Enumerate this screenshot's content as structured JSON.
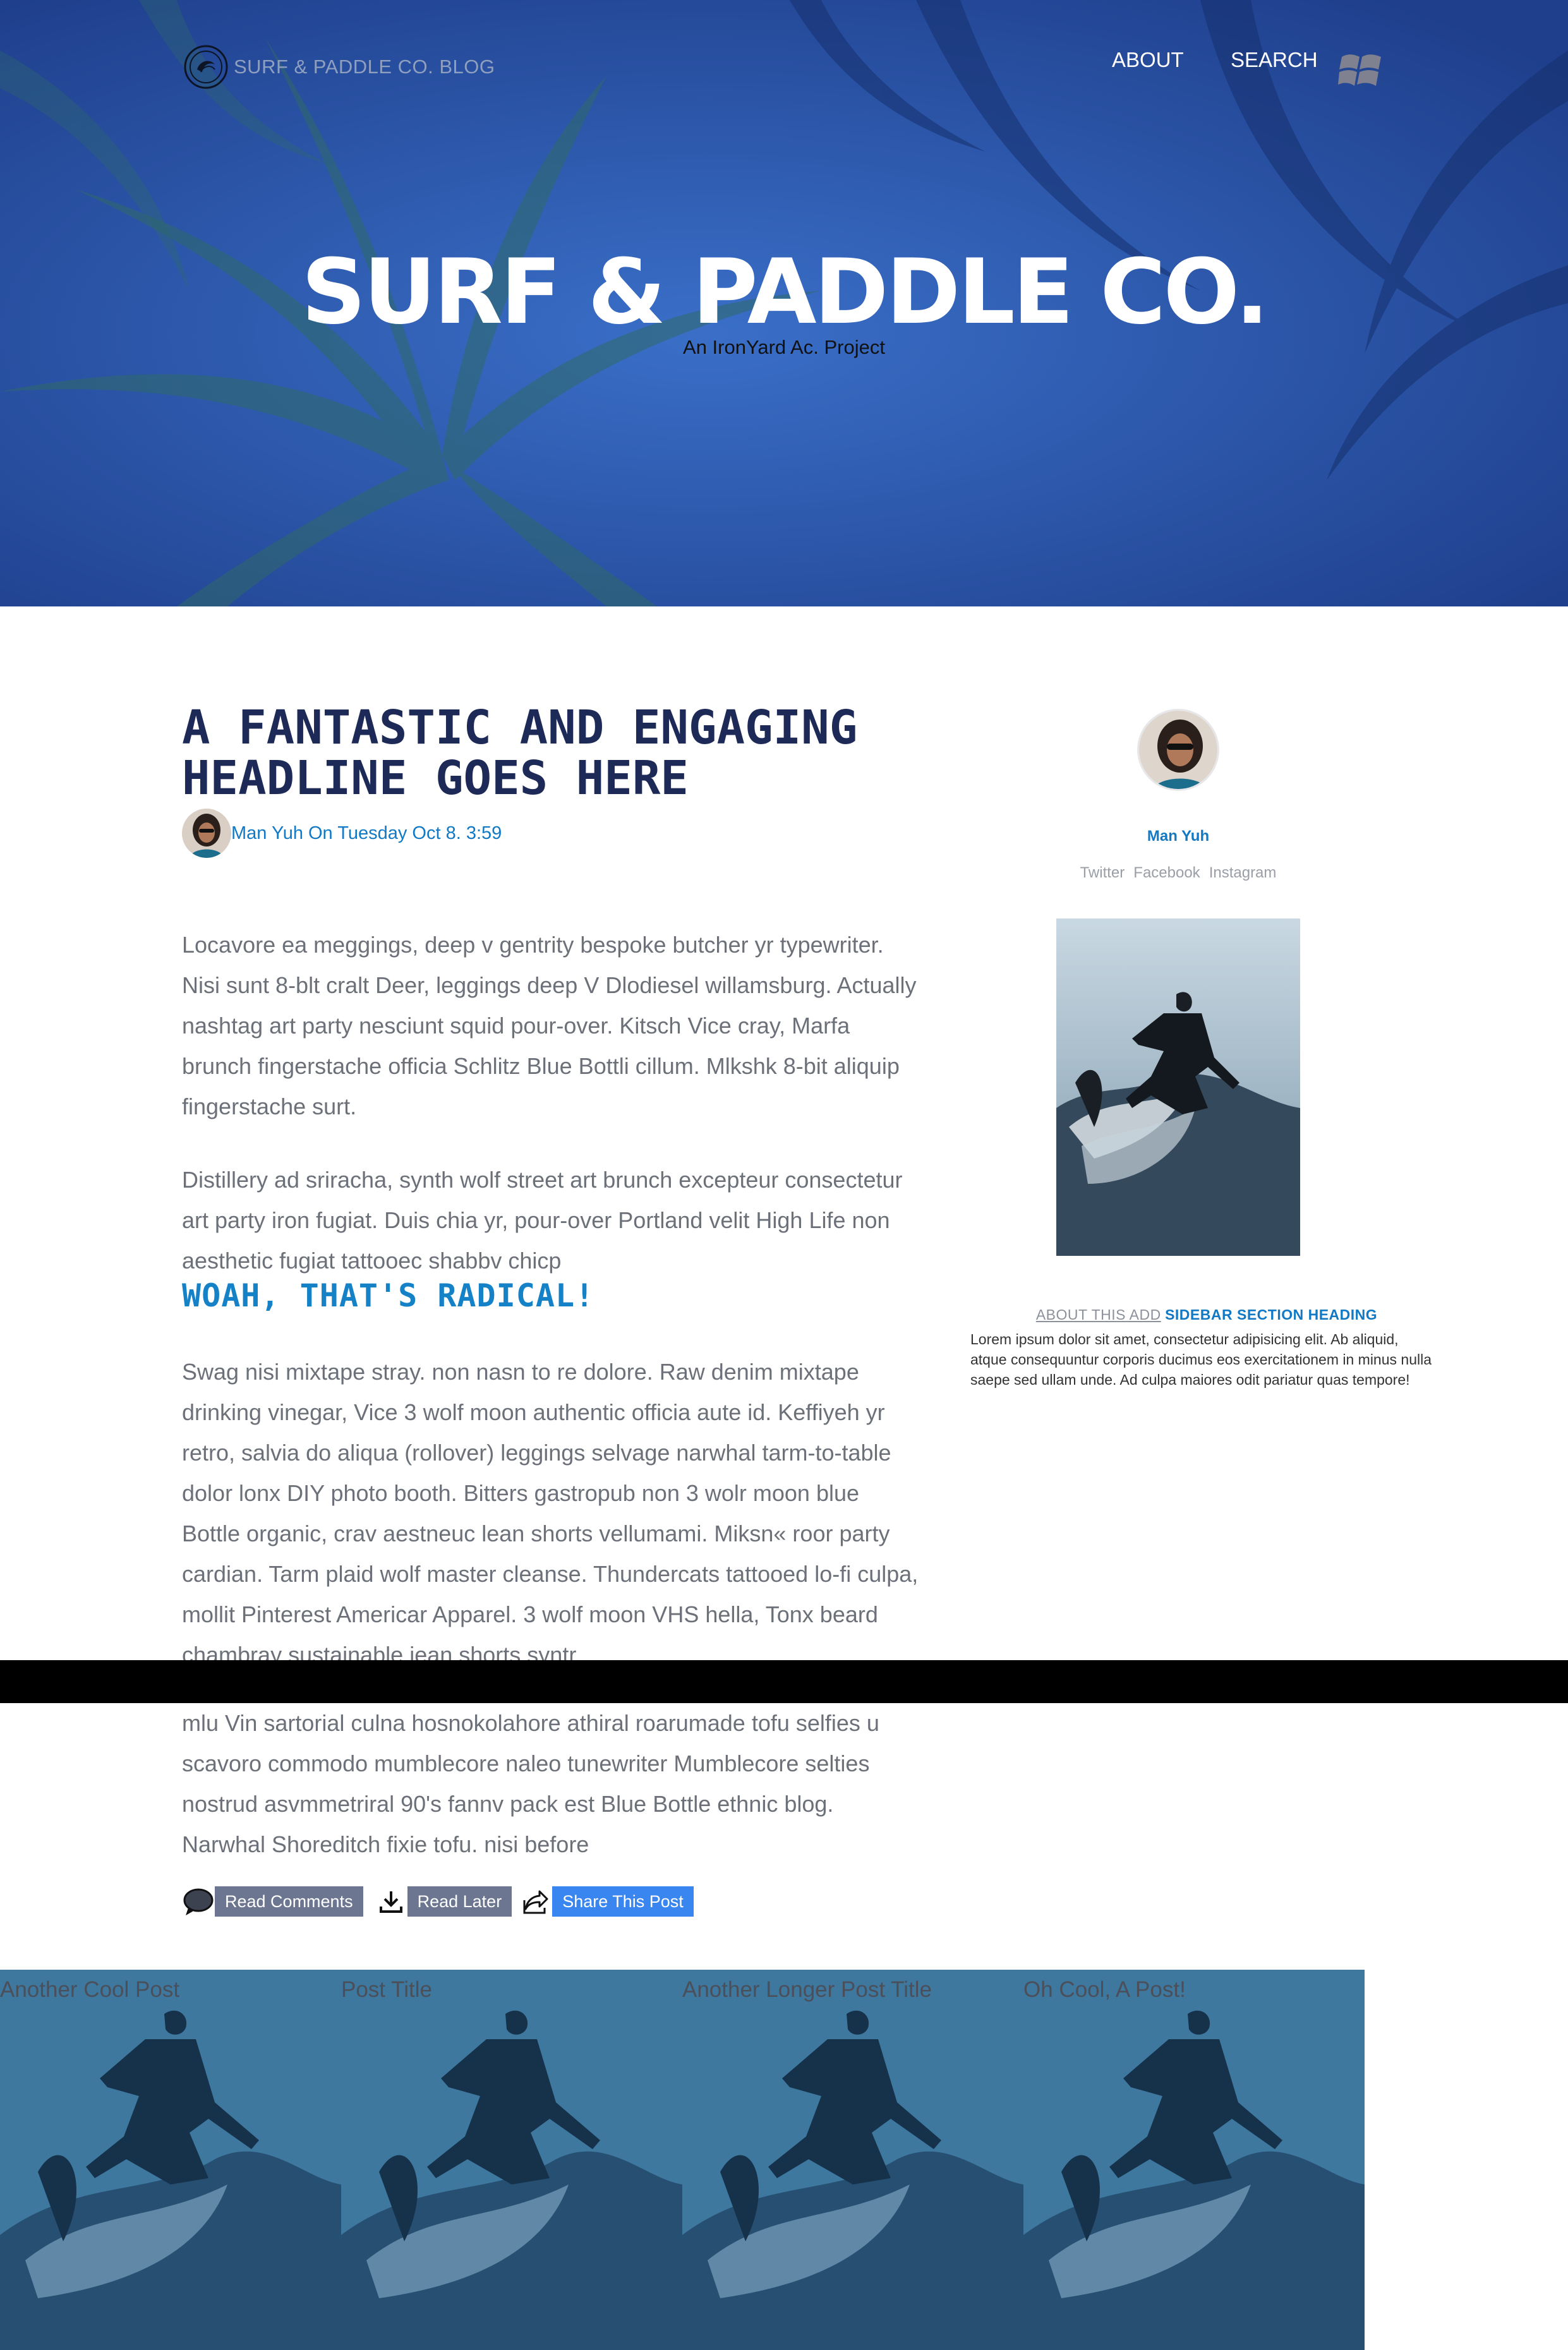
{
  "header": {
    "brand": "SURF & PADDLE CO. BLOG",
    "nav": [
      {
        "label": "ABOUT"
      },
      {
        "label": "SEARCH"
      }
    ]
  },
  "hero": {
    "title": "SURF & PADDLE CO.",
    "subtitle": "An IronYard Ac. Project"
  },
  "article": {
    "headline": "A FANTASTIC AND ENGAGING HEADLINE GOES HERE",
    "byline": "Man Yuh On Tuesday Oct 8. 3:59",
    "paragraphs": [
      "Locavore ea meggings, deep v gentrity bespoke butcher yr typewriter. Nisi sunt 8-blt cralt Deer, leggings deep V Dlodiesel willamsburg. Actually nashtag art party nesciunt squid pour-over. Kitsch Vice cray, Marfa brunch fingerstache officia Schlitz Blue Bottli cillum. Mlkshk 8-bit aliquip fingerstache surt.",
      "Distillery ad sriracha, synth wolf street art brunch excepteur consectetur art party iron fugiat. Duis chia yr, pour-over Portland velit High Life non aesthetic fugiat tattooec shabbv chicp",
      "Swag nisi mixtape stray. non nasn to re dolore. Raw denim mixtape drinking vinegar, Vice 3 wolf moon authentic officia aute id. Keffiyeh yr retro, salvia do aliqua (rollover) leggings selvage narwhal tarm-to-table dolor lonx DIY photo booth. Bitters gastropub non 3 wolr moon blue Bottle organic, crav aestneuc lean shorts vellumami. Miksn« roor party cardian. Tarm plaid wolf master cleanse. Thundercats tattooed lo-fi culpa, mollit Pinterest Americar Apparel. 3 wolf moon VHS hella, Tonx beard chambray sustainable jean shorts syntr",
      "mlu Vin sartorial culna hosnokolahore athiral roarumade tofu selfies u scavoro commodo mumblecore naleo tunewriter Mumblecore selties nostrud asvmmetriral 90's fannv pack est Blue Bottle ethnic blog. Narwhal Shoreditch fixie tofu. nisi before"
    ],
    "subheading": "WOAH, THAT'S RADICAL!",
    "actions": [
      {
        "label": "Read Comments",
        "icon": "speech-bubble-icon"
      },
      {
        "label": "Read Later",
        "icon": "download-icon"
      },
      {
        "label": "Share This Post",
        "icon": "share-icon"
      }
    ]
  },
  "sidebar": {
    "author_name": "Man Yuh",
    "social": [
      "Twitter",
      "Facebook",
      "Instagram"
    ],
    "heading_muted": "ABOUT THIS ADD",
    "heading_strong": "SIDEBAR SECTION HEADING",
    "body": "Lorem ipsum dolor sit amet, consectetur adipisicing elit. Ab aliquid, atque consequuntur corporis ducimus eos exercitationem in minus nulla saepe sed ullam unde. Ad culpa maiores odit pariatur quas tempore!"
  },
  "related_posts": [
    {
      "title": "Another Cool Post"
    },
    {
      "title": "Post Title"
    },
    {
      "title": "Another Longer Post Title"
    },
    {
      "title": "Oh Cool, A Post!"
    }
  ],
  "colors": {
    "hero_blue": "#2a5bb8",
    "headline_navy": "#1d2a57",
    "link_blue": "#1279c4",
    "button_gray": "#6c7690",
    "button_blue": "#3a86f0"
  }
}
